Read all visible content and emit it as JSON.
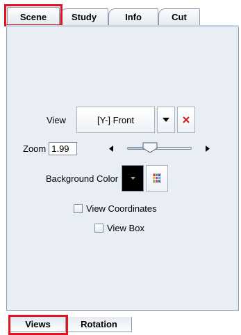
{
  "top_tabs": [
    {
      "label": "Scene",
      "active": true
    },
    {
      "label": "Study",
      "active": false
    },
    {
      "label": "Info",
      "active": false
    },
    {
      "label": "Cut",
      "active": false
    }
  ],
  "view": {
    "label": "View",
    "value": "[Y-] Front"
  },
  "zoom": {
    "label": "Zoom",
    "value": "1.99",
    "slider_fraction": 0.35
  },
  "background_color": {
    "label": "Background Color",
    "color": "#000000"
  },
  "checkboxes": {
    "view_coordinates": {
      "label": "View Coordinates",
      "checked": false
    },
    "view_box": {
      "label": "View Box",
      "checked": false
    }
  },
  "bottom_tabs": [
    {
      "label": "Views",
      "active": true
    },
    {
      "label": "Rotation",
      "active": false
    }
  ],
  "colors": {
    "highlight": "#e0141e",
    "panel_bg": "#e8eef4",
    "clear_icon": "#d11a1a"
  }
}
